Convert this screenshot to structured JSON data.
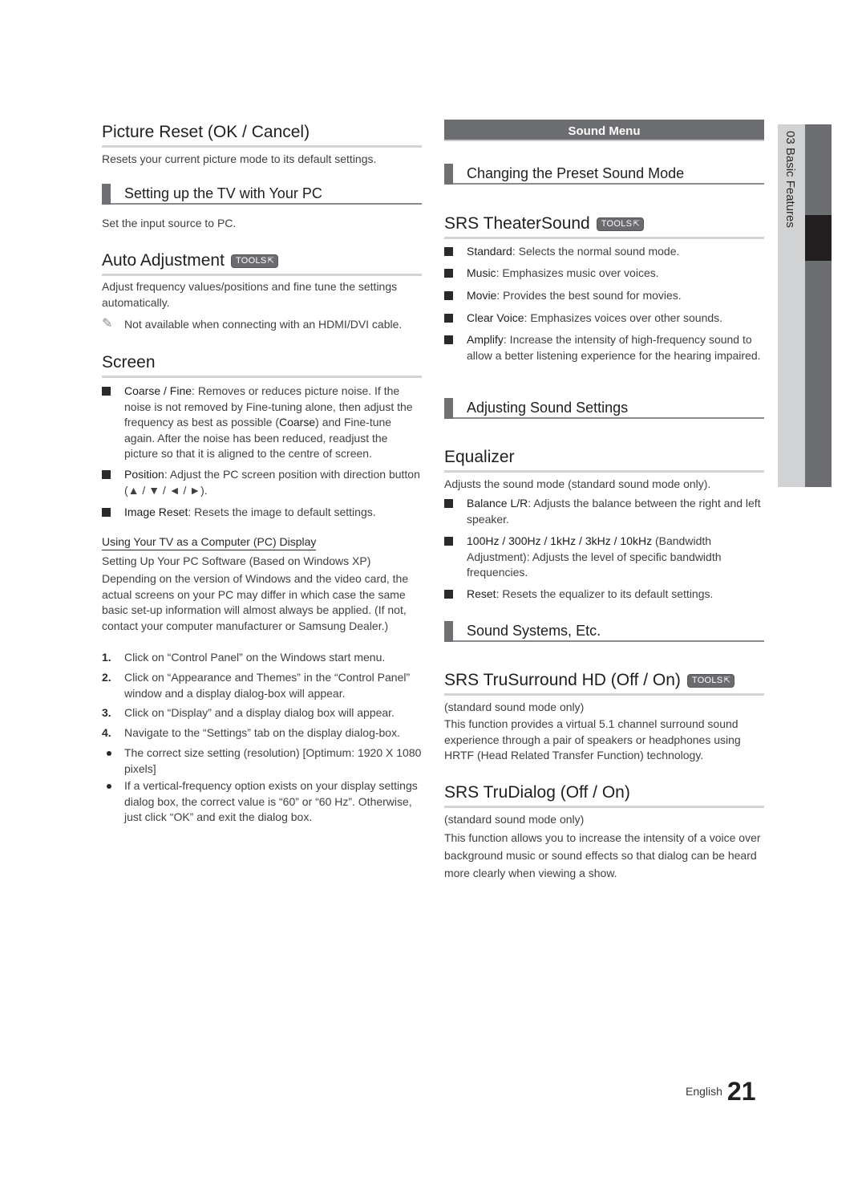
{
  "left": {
    "picture_reset": {
      "title": "Picture Reset (OK / Cancel)",
      "desc": "Resets your current picture mode to its default settings."
    },
    "setup_pc": {
      "title": "Setting up the TV with Your PC",
      "desc": "Set the input source to PC."
    },
    "auto_adjustment": {
      "title": "Auto Adjustment",
      "badge": "TOOLS",
      "desc": "Adjust frequency values/positions and fine tune the settings automatically.",
      "note": "Not available when connecting with an HDMI/DVI cable."
    },
    "screen": {
      "title": "Screen",
      "bullets": [
        {
          "term": "Coarse / Fine",
          "text": ": Removes or reduces picture noise. If the noise is not removed by Fine-tuning alone, then adjust the frequency as best as possible (",
          "term2": "Coarse",
          "text2": ") and Fine-tune again. After the noise has been reduced, readjust the picture so that it is aligned to the centre of screen."
        },
        {
          "term": "Position",
          "text": ": Adjust the PC screen position with direction button (▲ / ▼ / ◄ / ►)."
        },
        {
          "term": "Image Reset",
          "text": ": Resets the image to default settings."
        }
      ]
    },
    "pc_display": {
      "title": "Using Your TV as a Computer (PC) Display",
      "subtitle": "Setting Up Your PC Software (Based on Windows XP)",
      "desc": "Depending on the version of Windows and the video card, the actual screens on your PC may differ in which case the same basic set-up information will almost always be applied. (If not, contact your computer manufacturer or Samsung Dealer.)",
      "steps": [
        {
          "num": "1.",
          "text": "Click on “Control Panel” on the Windows start menu."
        },
        {
          "num": "2.",
          "text": "Click on “Appearance and Themes” in the “Control Panel” window and a display dialog-box will appear."
        },
        {
          "num": "3.",
          "text": "Click on “Display” and a display dialog box will appear."
        },
        {
          "num": "4.",
          "text": "Navigate to the “Settings” tab on the display dialog-box."
        }
      ],
      "dots": [
        "The correct size setting (resolution) [Optimum: 1920 X 1080 pixels]",
        "If a vertical-frequency option exists on your display settings dialog box, the correct value is “60” or “60 Hz”. Otherwise, just click “OK” and exit the dialog box."
      ]
    }
  },
  "right": {
    "sound_menu": "Sound Menu",
    "preset": {
      "title": "Changing the Preset Sound Mode"
    },
    "theater": {
      "title": "SRS TheaterSound",
      "badge": "TOOLS",
      "bullets": [
        {
          "term": "Standard",
          "text": ": Selects the normal sound mode."
        },
        {
          "term": "Music",
          "text": ": Emphasizes music over voices."
        },
        {
          "term": "Movie",
          "text": ": Provides the best sound for movies."
        },
        {
          "term": "Clear Voice",
          "text": ": Emphasizes voices over other sounds."
        },
        {
          "term": "Amplify",
          "text": ": Increase the intensity of high-frequency sound to allow a better listening experience for the hearing impaired."
        }
      ]
    },
    "adjusting": {
      "title": "Adjusting Sound Settings"
    },
    "equalizer": {
      "title": "Equalizer",
      "desc": "Adjusts the sound mode (standard sound mode only).",
      "bullets": [
        {
          "term": "Balance L/R",
          "text": ": Adjusts the balance between the right and left speaker."
        },
        {
          "term": "100Hz / 300Hz / 1kHz / 3kHz / 10kHz",
          "text": " (Bandwidth Adjustment): Adjusts the level of specific bandwidth frequencies."
        },
        {
          "term": "Reset",
          "text": ": Resets the equalizer to its default settings."
        }
      ]
    },
    "systems": {
      "title": "Sound Systems, Etc."
    },
    "trusurround": {
      "title": "SRS TruSurround HD (Off / On)",
      "badge": "TOOLS",
      "mode": "(standard sound mode only)",
      "desc": "This function provides a virtual 5.1 channel surround sound experience through a pair of speakers or headphones using HRTF (Head Related Transfer Function) technology."
    },
    "trudialog": {
      "title": "SRS TruDialog (Off / On)",
      "mode": "(standard sound mode only)",
      "desc": "This function allows you to increase the intensity of a voice over background music or sound effects so that dialog can be heard more clearly when viewing a show."
    }
  },
  "side_tab": {
    "label": "03  Basic Features"
  },
  "footer": {
    "language": "English",
    "page_number": "21"
  },
  "icons": {
    "tools_glyph": "⇱",
    "note_glyph": "✎"
  }
}
